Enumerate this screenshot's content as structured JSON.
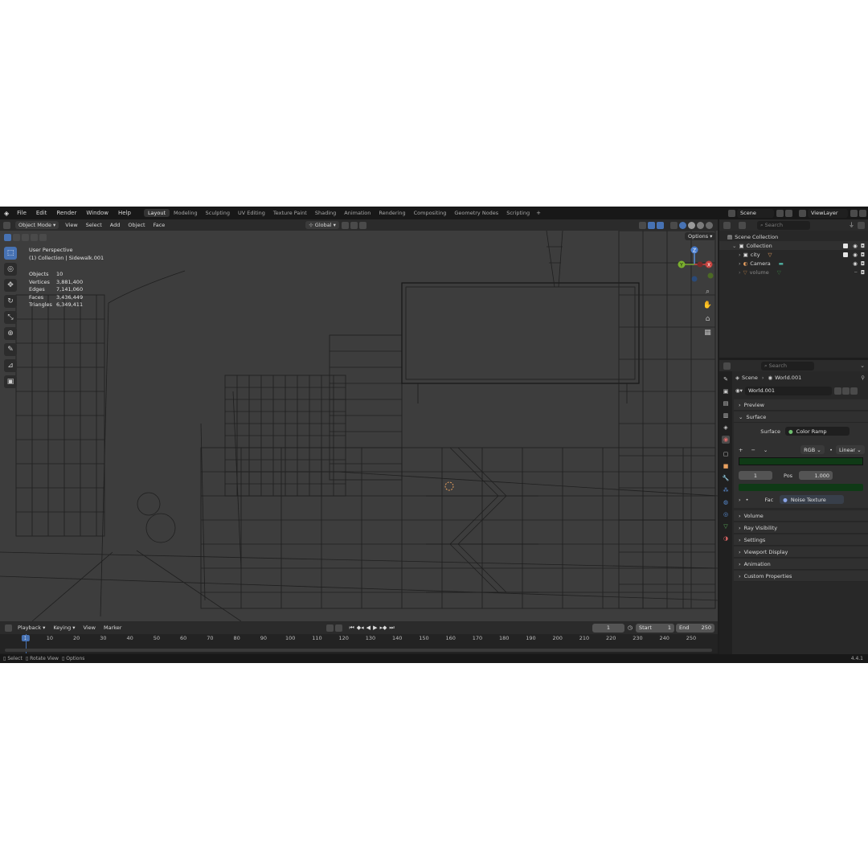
{
  "menu": [
    "File",
    "Edit",
    "Render",
    "Window",
    "Help"
  ],
  "workspaces": [
    "Layout",
    "Modeling",
    "Sculpting",
    "UV Editing",
    "Texture Paint",
    "Shading",
    "Animation",
    "Rendering",
    "Compositing",
    "Geometry Nodes",
    "Scripting"
  ],
  "active_workspace": "Layout",
  "scene_name": "Scene",
  "view_layer": "ViewLayer",
  "viewport_header": {
    "mode": "Object Mode",
    "menus": [
      "View",
      "Select",
      "Add",
      "Object",
      "Face"
    ],
    "transform": "Global",
    "options": "Options"
  },
  "viewport_info": {
    "perspective": "User Perspective",
    "collection_line": "(1) Collection | Sidewalk.001"
  },
  "stats": [
    {
      "label": "Objects",
      "value": "10"
    },
    {
      "label": "Vertices",
      "value": "3,881,400"
    },
    {
      "label": "Edges",
      "value": "7,141,060"
    },
    {
      "label": "Faces",
      "value": "3,436,449"
    },
    {
      "label": "Triangles",
      "value": "6,349,411"
    }
  ],
  "gizmo": {
    "z": "Z",
    "y": "Y",
    "x": "X"
  },
  "timeline": {
    "menus": [
      "Playback",
      "Keying",
      "View",
      "Marker"
    ],
    "current_frame": "1",
    "start_label": "Start",
    "start": "1",
    "end_label": "End",
    "end": "250",
    "ticks": [
      "1",
      "10",
      "20",
      "30",
      "40",
      "50",
      "60",
      "70",
      "80",
      "90",
      "100",
      "110",
      "120",
      "130",
      "140",
      "150",
      "160",
      "170",
      "180",
      "190",
      "200",
      "210",
      "220",
      "230",
      "240",
      "250"
    ]
  },
  "status_bar": {
    "select": "Select",
    "rotate": "Rotate View",
    "options": "Options",
    "version": "4.4.1"
  },
  "outliner": {
    "search_placeholder": "Search",
    "root": "Scene Collection",
    "collection": "Collection",
    "items": [
      "city",
      "Camera",
      "volume"
    ]
  },
  "properties": {
    "search_placeholder": "Search",
    "breadcrumb_scene": "Scene",
    "breadcrumb_world": "World.001",
    "world_name": "World.001",
    "preview": "Preview",
    "surface_header": "Surface",
    "surface_label": "Surface",
    "surface_value": "Color Ramp",
    "color_mode": "RGB",
    "interpolation": "Linear",
    "stop_index": "1",
    "pos_label": "Pos",
    "pos_value": "1.000",
    "fac_label": "Fac",
    "fac_value": "Noise Texture",
    "sections": [
      "Volume",
      "Ray Visibility",
      "Settings",
      "Viewport Display",
      "Animation",
      "Custom Properties"
    ]
  },
  "colors": {
    "accent": "#4772b3",
    "ramp": "#0f3a16",
    "background": "#3d3d3d"
  }
}
